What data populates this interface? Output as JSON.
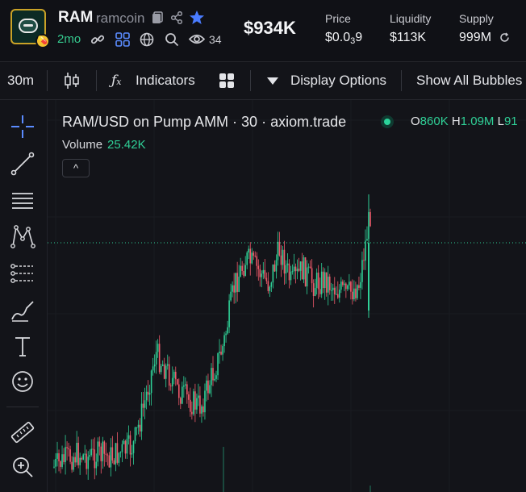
{
  "token": {
    "symbol": "RAM",
    "name": "ramcoin",
    "age": "2mo",
    "views": "34",
    "market_cap": "$934K"
  },
  "stats": [
    {
      "label": "Price",
      "value_prefix": "$0.0",
      "value_sub": "3",
      "value_suffix": "9"
    },
    {
      "label": "Liquidity",
      "value": "$113K"
    },
    {
      "label": "Supply",
      "value": "999M"
    }
  ],
  "toolbar": {
    "interval": "30m",
    "indicators_label": "Indicators",
    "display_options_label": "Display Options",
    "show_bubbles_label": "Show All Bubbles"
  },
  "chart_header": {
    "title": "RAM/USD on Pump AMM · 30 · axiom.trade",
    "ohlc": [
      {
        "k": "O",
        "v": "860K"
      },
      {
        "k": "H",
        "v": "1.09M"
      },
      {
        "k": "L",
        "v": "91"
      }
    ],
    "volume_label": "Volume",
    "volume_value": "25.42K"
  },
  "left_tools": [
    "crosshair-icon",
    "trend-line-icon",
    "fib-icon",
    "pattern-icon",
    "projection-icon",
    "brush-icon",
    "text-icon",
    "emoji-icon",
    "ruler-icon",
    "zoom-in-icon"
  ],
  "colors": {
    "up": "#2fcf96",
    "down": "#f05a6b",
    "background": "#131419",
    "accent": "#2bd39a",
    "star": "#4a7cff"
  },
  "chart_data": {
    "type": "candlestick",
    "title": "RAM/USD on Pump AMM · 30 · axiom.trade",
    "price_trend": [
      0.0,
      0.03,
      0.05,
      0.04,
      0.05,
      0.04,
      0.06,
      0.08,
      0.25,
      0.45,
      0.38,
      0.3,
      0.26,
      0.24,
      0.36,
      0.48,
      0.72,
      0.82,
      0.78,
      0.72,
      0.86,
      0.72,
      0.78,
      0.72,
      0.74,
      0.7,
      0.68,
      0.72,
      1.0
    ],
    "last_price_line": "dotted"
  }
}
